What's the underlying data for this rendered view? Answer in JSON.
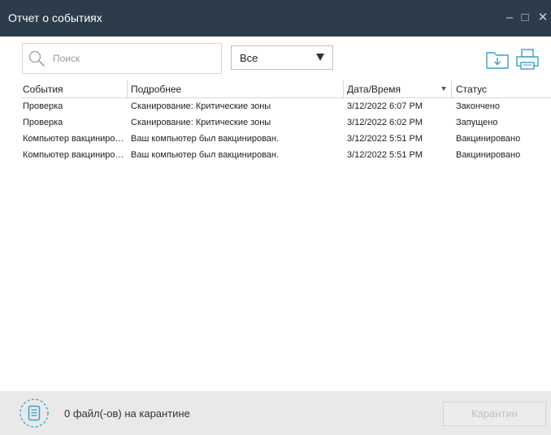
{
  "window": {
    "title": "Отчет о событиях",
    "controls": {
      "minimize": "–",
      "maximize": "□",
      "close": "✕"
    }
  },
  "toolbar": {
    "search": {
      "value": "",
      "placeholder": "Поиск",
      "icon": "search-icon"
    },
    "filter": {
      "selected": "Все"
    },
    "export_icon": "folder-download-icon",
    "print_icon": "printer-icon"
  },
  "table": {
    "columns": [
      "События",
      "Подробнее",
      "Дата/Время",
      "Статус"
    ],
    "sort": {
      "column": "Дата/Время",
      "direction": "desc"
    },
    "rows": [
      {
        "event": "Компьютер вакциниро…",
        "details": "Ваш компьютер был вакцинирован.",
        "datetime": "3/12/2022 5:51 PM",
        "status": "Вакцинировано"
      },
      {
        "event": "Компьютер вакциниро…",
        "details": "Ваш компьютер был вакцинирован.",
        "datetime": "3/12/2022 5:51 PM",
        "status": "Вакцинировано"
      },
      {
        "event": "Проверка",
        "details": "Сканирование: Критические зоны",
        "datetime": "3/12/2022 6:02 PM",
        "status": "Запущено"
      },
      {
        "event": "Проверка",
        "details": "Сканирование: Критические зоны",
        "datetime": "3/12/2022 6:07 PM",
        "status": "Закончено"
      }
    ]
  },
  "footer": {
    "quarantine_text": "0 файл(-ов) на карантине",
    "quarantine_button": "Карантин",
    "quarantine_icon": "quarantine-icon"
  },
  "colors": {
    "titlebar": "#2d3c4a",
    "footer": "#e9e9e9",
    "accent": "#3aa0c8"
  }
}
